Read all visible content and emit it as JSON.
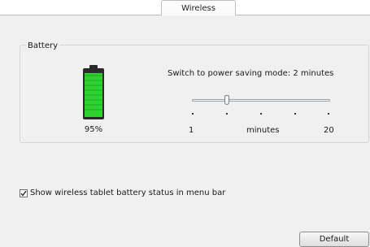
{
  "tabs": {
    "active_label": "Wireless"
  },
  "battery_group": {
    "label": "Battery",
    "level_percent": 95,
    "level_label": "95%",
    "fill_color": "#2fd12f"
  },
  "power_saving": {
    "label": "Switch to power saving mode: 2 minutes",
    "value_minutes": 2,
    "min": 1,
    "max": 20,
    "min_label": "1",
    "max_label": "20",
    "unit_label": "minutes"
  },
  "show_status": {
    "checked": true,
    "label": "Show wireless tablet battery status in menu bar"
  },
  "buttons": {
    "default_label": "Default"
  },
  "icons": {
    "battery": "battery-icon",
    "checkmark": "checkmark-icon"
  }
}
